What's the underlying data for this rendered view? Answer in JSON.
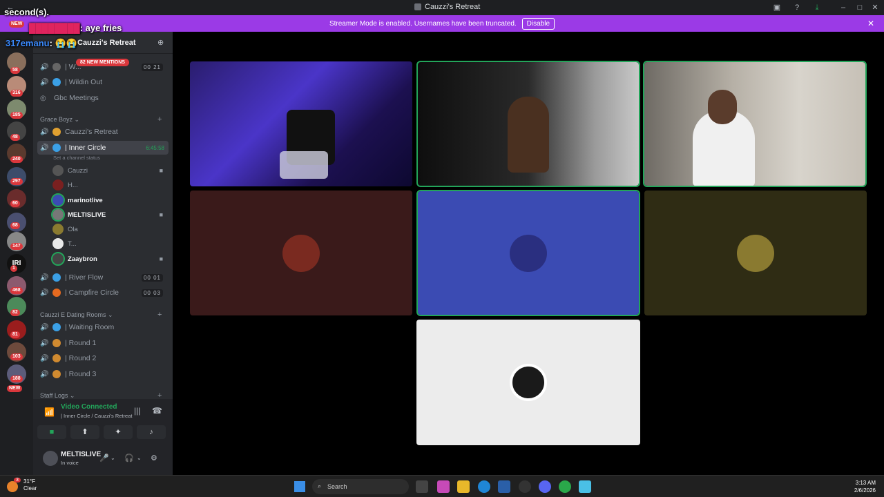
{
  "window": {
    "title": "Cauzzi's Retreat"
  },
  "banner": {
    "text": "Streamer Mode is enabled. Usernames have been truncated.",
    "button": "Disable"
  },
  "overlay": {
    "line1": "second(s).",
    "line2_user": "████████",
    "line2_msg": "aye fries",
    "line3_user": "317emanu",
    "line3_msg": "😭😭"
  },
  "server": {
    "name": "Cauzzi's Retreat",
    "mentions": "82 NEW MENTIONS"
  },
  "server_badges": [
    "NEW",
    "58",
    "316",
    "185",
    "48",
    "240",
    "297",
    "60",
    "68",
    "147",
    "1",
    "468",
    "82",
    "81",
    "103",
    "188",
    "NEW"
  ],
  "channels_top": [
    {
      "label": "| W...",
      "count": "00 21"
    },
    {
      "label": "| Wildin Out"
    },
    {
      "label": "Gbc Meetings"
    }
  ],
  "categories": {
    "grace": "Grace Boyz",
    "dating": "Cauzzi E Dating Rooms",
    "staff": "Staff Logs"
  },
  "grace_channels": [
    {
      "label": "Cauzzi's Retreat"
    },
    {
      "label": "| Inner Circle",
      "timer": "6:45:58",
      "status": "Set a channel status"
    }
  ],
  "members": [
    {
      "name": "Cauzzi",
      "bold": false,
      "cam": true
    },
    {
      "name": "H...",
      "bold": false,
      "cam": false
    },
    {
      "name": "marinotlive",
      "bold": true,
      "cam": false
    },
    {
      "name": "MELTISLIVE",
      "bold": true,
      "cam": true
    },
    {
      "name": "Ola",
      "bold": false,
      "cam": false
    },
    {
      "name": "T...",
      "bold": false,
      "cam": false
    },
    {
      "name": "Zaaybron",
      "bold": true,
      "cam": true
    }
  ],
  "other_channels": [
    {
      "label": "| River Flow",
      "count": "00 01"
    },
    {
      "label": "| Campfire Circle",
      "count": "00 03"
    }
  ],
  "dating_channels": [
    {
      "label": "| Waiting Room"
    },
    {
      "label": "| Round 1"
    },
    {
      "label": "| Round 2"
    },
    {
      "label": "| Round 3"
    }
  ],
  "voice": {
    "title": "Video Connected",
    "subtitle": "| Inner Circle / Cauzzi's Retreat"
  },
  "user": {
    "name": "MELTISLIVE",
    "status": "In voice"
  },
  "taskbar": {
    "weather_temp": "31°F",
    "weather_desc": "Clear",
    "search": "Search",
    "time": "3:13 AM",
    "date": "2/6/2026",
    "notif": "3"
  },
  "colors": {
    "brand_purple": "#9b3ae6",
    "speaking_green": "#23a55a",
    "tile_red": "#3a1a1a",
    "tile_blue": "#3b4bb3",
    "tile_olive": "#2f2c14",
    "tile_white": "#ececec"
  }
}
